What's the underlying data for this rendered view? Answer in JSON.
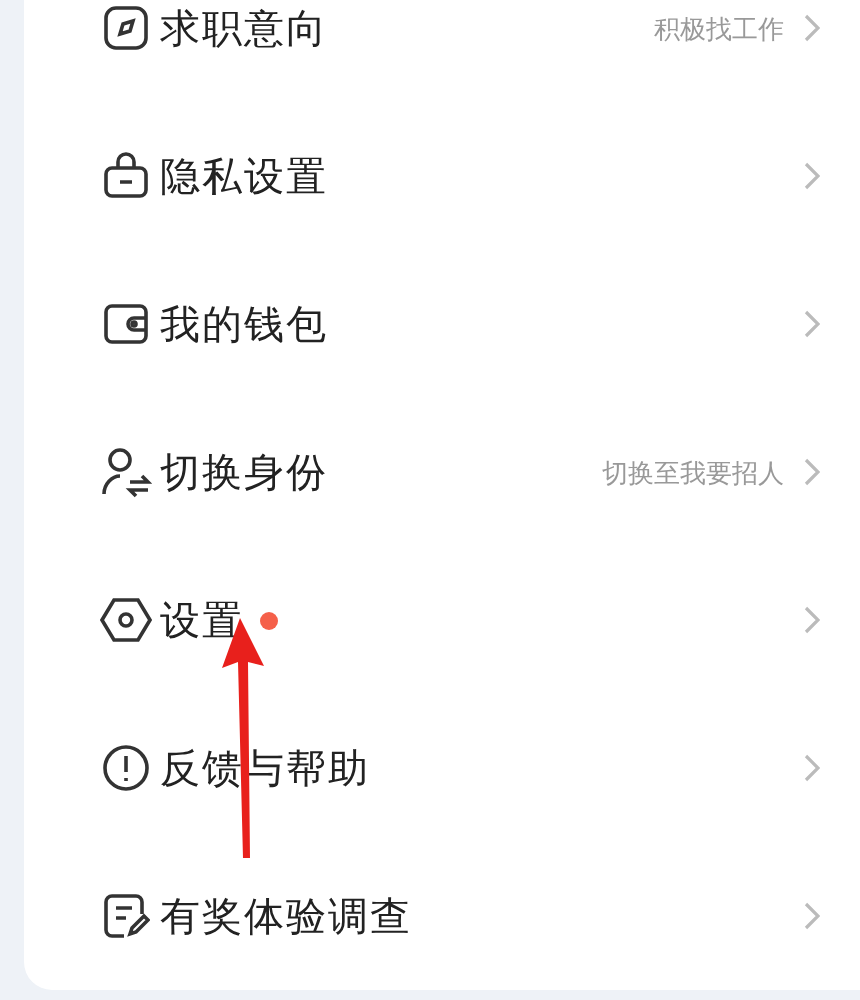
{
  "menu_items": [
    {
      "label": "求职意向",
      "hint": "积极找工作",
      "new_dot": false
    },
    {
      "label": "隐私设置",
      "new_dot": false
    },
    {
      "label": "我的钱包",
      "new_dot": false
    },
    {
      "label": "切换身份",
      "hint": "切换至我要招人",
      "new_dot": false
    },
    {
      "label": "设置",
      "new_dot": true
    },
    {
      "label": "反馈与帮助",
      "new_dot": false
    },
    {
      "label": "有奖体验调查",
      "new_dot": false
    }
  ]
}
